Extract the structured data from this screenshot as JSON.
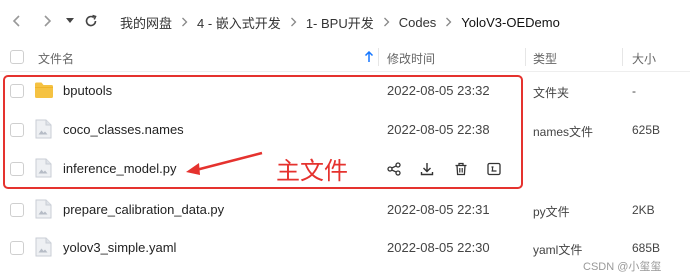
{
  "breadcrumb": [
    "我的网盘",
    "4 - 嵌入式开发",
    "1- BPU开发",
    "Codes",
    "YoloV3-OEDemo"
  ],
  "columns": {
    "name": "文件名",
    "modified": "修改时间",
    "type": "类型",
    "size": "大小"
  },
  "files": [
    {
      "name": "bputools",
      "modified": "2022-08-05 23:32",
      "type": "文件夹",
      "size": "-",
      "icon": "folder-icon"
    },
    {
      "name": "coco_classes.names",
      "modified": "2022-08-05 22:38",
      "type": "names文件",
      "size": "625B",
      "icon": "file-icon"
    },
    {
      "name": "inference_model.py",
      "modified": "",
      "type": "",
      "size": "",
      "icon": "file-icon",
      "hovered": true
    },
    {
      "name": "prepare_calibration_data.py",
      "modified": "2022-08-05 22:31",
      "type": "py文件",
      "size": "2KB",
      "icon": "file-icon"
    },
    {
      "name": "yolov3_simple.yaml",
      "modified": "2022-08-05 22:30",
      "type": "yaml文件",
      "size": "685B",
      "icon": "file-icon"
    }
  ],
  "annotation": {
    "text": "主文件",
    "color": "#e5322e"
  },
  "watermark": "CSDN @小玺玺",
  "colors": {
    "accent": "#1677ff",
    "annotation": "#e5322e",
    "folder": "#f5c242"
  }
}
